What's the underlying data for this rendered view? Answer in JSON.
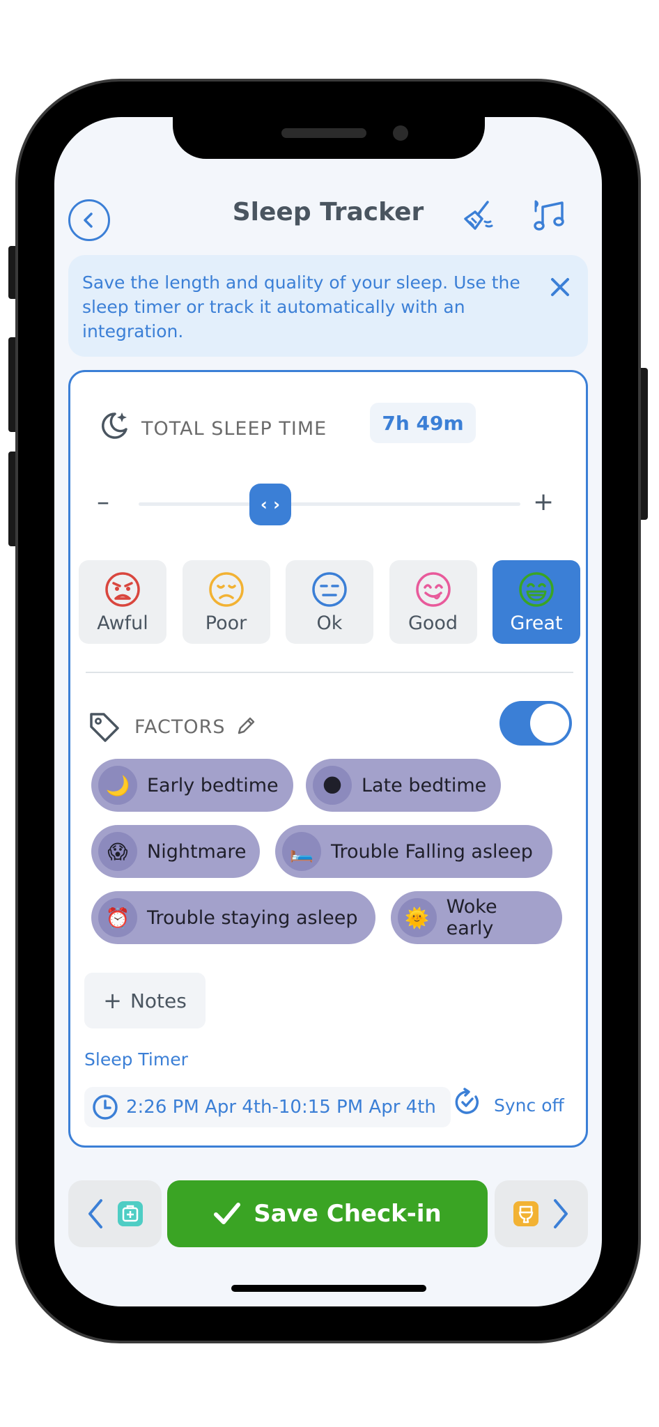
{
  "header": {
    "title": "Sleep Tracker"
  },
  "banner": {
    "text": "Save the length and quality of your sleep. Use the sleep timer or track it automatically with an integration."
  },
  "sleep": {
    "label": "TOTAL SLEEP TIME",
    "total": "7h 49m",
    "minus": "–",
    "plus": "+",
    "handle_glyph": "‹ ›",
    "slider_level": 0.33
  },
  "moods": [
    {
      "label": "Awful",
      "color": "#d9463e"
    },
    {
      "label": "Poor",
      "color": "#f2b233"
    },
    {
      "label": "Ok",
      "color": "#3b7fd6"
    },
    {
      "label": "Good",
      "color": "#e85a9b"
    },
    {
      "label": "Great",
      "color": "#3aa424",
      "selected": true
    }
  ],
  "factors": {
    "label": "FACTORS",
    "enabled": true,
    "chips": [
      {
        "emoji": "🌙",
        "label": "Early bedtime"
      },
      {
        "emoji": "🌑",
        "label": "Late bedtime"
      },
      {
        "emoji": "😱",
        "label": "Nightmare"
      },
      {
        "emoji": "🛏️",
        "label": "Trouble Falling asleep"
      },
      {
        "emoji": "⏰",
        "label": "Trouble staying asleep"
      },
      {
        "emoji": "🌞",
        "label": "Woke early"
      }
    ]
  },
  "notes": {
    "label": "Notes",
    "plus": "+"
  },
  "timer": {
    "label": "Sleep Timer",
    "range": "2:26 PM Apr 4th-10:15 PM Apr 4th",
    "sync": "Sync off"
  },
  "footer": {
    "save_label": "Save Check-in"
  },
  "colors": {
    "accent": "#3b7fd6",
    "save_green": "#3aa424",
    "chip_bg": "#a3a1cb"
  }
}
